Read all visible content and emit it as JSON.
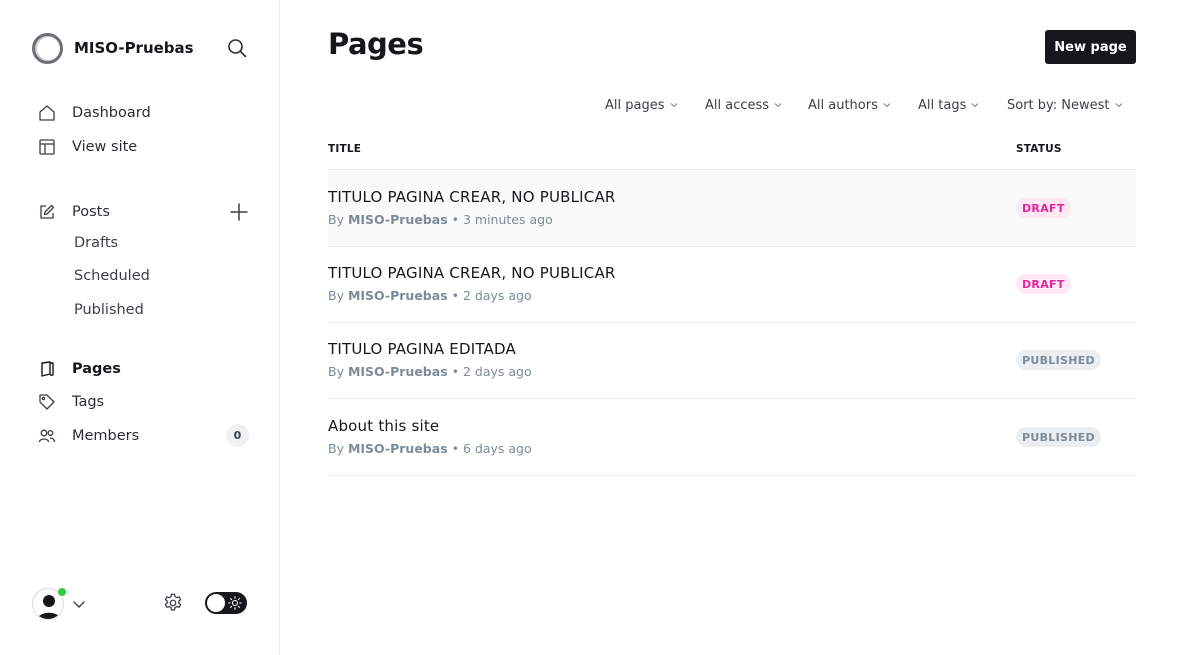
{
  "sidebar": {
    "site_name": "MISO-Pruebas",
    "nav": {
      "dashboard": "Dashboard",
      "view_site": "View site",
      "posts": "Posts",
      "drafts": "Drafts",
      "scheduled": "Scheduled",
      "published": "Published",
      "pages": "Pages",
      "tags": "Tags",
      "members": "Members",
      "members_count": "0"
    }
  },
  "main": {
    "title": "Pages",
    "new_page_label": "New page",
    "filters": {
      "type": "All pages",
      "access": "All access",
      "authors": "All authors",
      "tags": "All tags",
      "sort": "Sort by: Newest"
    },
    "columns": {
      "title": "TITLE",
      "status": "STATUS"
    },
    "rows": [
      {
        "title": "TITULO PAGINA CREAR, NO PUBLICAR",
        "by": "By",
        "author": "MISO-Pruebas",
        "time": "• 3 minutes ago",
        "status": "DRAFT"
      },
      {
        "title": "TITULO PAGINA CREAR, NO PUBLICAR",
        "by": "By",
        "author": "MISO-Pruebas",
        "time": "• 2 days ago",
        "status": "DRAFT"
      },
      {
        "title": "TITULO PAGINA EDITADA",
        "by": "By",
        "author": "MISO-Pruebas",
        "time": "• 2 days ago",
        "status": "PUBLISHED"
      },
      {
        "title": "About this site",
        "by": "By",
        "author": "MISO-Pruebas",
        "time": "• 6 days ago",
        "status": "PUBLISHED"
      }
    ]
  },
  "colors": {
    "accent_dark": "#15171a",
    "draft_text": "#e4279e",
    "draft_bg": "#fde8f4",
    "published_text": "#7c8b9a",
    "published_bg": "#ebeef0",
    "online": "#30cf43"
  },
  "icons": [
    "site-logo-icon",
    "search-icon",
    "home-icon",
    "layout-icon",
    "edit-icon",
    "plus-icon",
    "page-icon",
    "tag-icon",
    "members-icon",
    "user-avatar-icon",
    "chevron-down-icon",
    "gear-icon",
    "sun-icon"
  ]
}
